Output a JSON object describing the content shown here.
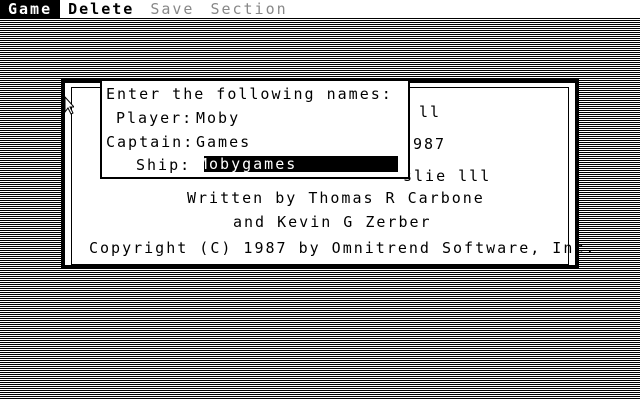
{
  "menu": {
    "items": [
      {
        "label": "Game",
        "state": "active"
      },
      {
        "label": "Delete",
        "state": "enabled"
      },
      {
        "label": "Save",
        "state": "disabled"
      },
      {
        "label": "Section",
        "state": "disabled"
      }
    ]
  },
  "title_screen": {
    "partial_right_1": "ll",
    "partial_right_2": "987",
    "partial_right_3": "slie lll",
    "credit_1": "Written by Thomas R Carbone",
    "credit_2": "and Kevin G Zerber",
    "copyright": "Copyright (C) 1987 by Omnitrend Software, Inc."
  },
  "dialog": {
    "prompt": "Enter the following names:",
    "player_label": "Player:",
    "player_value": "Moby",
    "captain_label": "Captain:",
    "captain_value": "Games",
    "ship_label": "Ship:",
    "ship_value": "Mobygames"
  },
  "colors": {
    "fg": "#000000",
    "bg": "#ffffff"
  }
}
